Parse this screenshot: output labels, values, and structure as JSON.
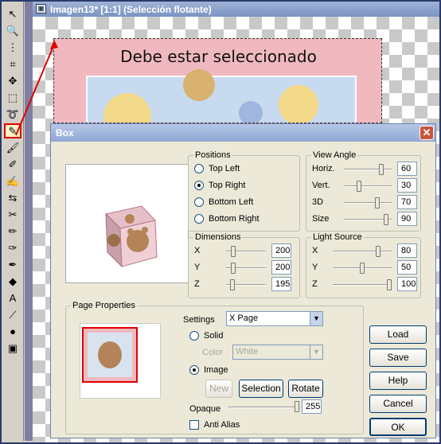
{
  "document": {
    "title": "Imagen13* [1:1] (Selección flotante)",
    "banner_text": "Debe estar seleccionado"
  },
  "toolbar": {
    "tools": [
      {
        "icon": "arrow-icon",
        "glyph": "↖"
      },
      {
        "icon": "zoom-icon",
        "glyph": "🔍"
      },
      {
        "icon": "deform-icon",
        "glyph": "⋮"
      },
      {
        "icon": "crop-icon",
        "glyph": "⌗"
      },
      {
        "icon": "move-icon",
        "glyph": "✥"
      },
      {
        "icon": "selection-icon",
        "glyph": "⬚"
      },
      {
        "icon": "lasso-icon",
        "glyph": "➰"
      },
      {
        "icon": "dropper-icon",
        "glyph": "✎"
      },
      {
        "icon": "paintbrush-icon",
        "glyph": "🖌"
      },
      {
        "icon": "clone-icon",
        "glyph": "✐"
      },
      {
        "icon": "color-replacer-icon",
        "glyph": "✍"
      },
      {
        "icon": "retouch-icon",
        "glyph": "⇆"
      },
      {
        "icon": "scratch-remover-icon",
        "glyph": "✂"
      },
      {
        "icon": "eraser-icon",
        "glyph": "✏"
      },
      {
        "icon": "picture-tube-icon",
        "glyph": "✑"
      },
      {
        "icon": "airbrush-icon",
        "glyph": "✒"
      },
      {
        "icon": "flood-fill-icon",
        "glyph": "◆"
      },
      {
        "icon": "text-icon",
        "glyph": "A"
      },
      {
        "icon": "draw-icon",
        "glyph": "⟋"
      },
      {
        "icon": "preset-shapes-icon",
        "glyph": "●"
      },
      {
        "icon": "object-selector-icon",
        "glyph": "▣"
      }
    ],
    "selected_index": 7
  },
  "dialog": {
    "title": "Box",
    "close_glyph": "✕",
    "positions": {
      "legend": "Positions",
      "options": [
        "Top Left",
        "Top Right",
        "Bottom Left",
        "Bottom Right"
      ],
      "selected": 1
    },
    "view_angle": {
      "legend": "View Angle",
      "rows": [
        {
          "label": "Horiz.",
          "value": "60",
          "level": 0.82
        },
        {
          "label": "Vert.",
          "value": "30",
          "level": 0.3
        },
        {
          "label": "3D",
          "value": "70",
          "level": 0.72
        },
        {
          "label": "Size",
          "value": "90",
          "level": 0.92
        }
      ]
    },
    "dimensions": {
      "legend": "Dimensions",
      "rows": [
        {
          "label": "X",
          "value": "200",
          "level": 0.13
        },
        {
          "label": "Y",
          "value": "200",
          "level": 0.13
        },
        {
          "label": "Z",
          "value": "195",
          "level": 0.12
        }
      ]
    },
    "light_source": {
      "legend": "Light Source",
      "rows": [
        {
          "label": "X",
          "value": "80",
          "level": 0.8
        },
        {
          "label": "Y",
          "value": "50",
          "level": 0.5
        },
        {
          "label": "Z",
          "value": "100",
          "level": 1.0
        }
      ]
    },
    "page_properties": {
      "legend": "Page Properties",
      "settings_label": "Settings",
      "settings_value": "X Page",
      "solid_label": "Solid",
      "color_label": "Color",
      "color_value": "White",
      "image_label": "Image",
      "new_label": "New",
      "selection_label": "Selection",
      "rotate_label": "Rotate",
      "opaque_label": "Opaque",
      "opaque_value": "255",
      "opaque_level": 1.0,
      "anti_alias_label": "Anti Alias"
    },
    "buttons": {
      "load": "Load",
      "save": "Save",
      "help": "Help",
      "cancel": "Cancel",
      "ok": "OK"
    }
  },
  "colors": {
    "accent_red": "#e00000",
    "dialog_bg": "#ece9d8",
    "title_bar": "#90a8d4"
  }
}
